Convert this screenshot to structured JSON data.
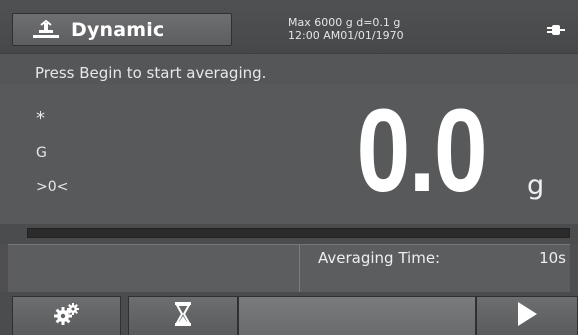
{
  "header": {
    "mode_label": "Dynamic",
    "mode_icon": "scale-balance-icon",
    "capacity_line": "Max 6000 g  d=0.1 g",
    "datetime_line": "12:00 AM01/01/1970",
    "power_icon": "power-plug-icon"
  },
  "message": "Press Begin to start averaging.",
  "display": {
    "stable_indicator": "*",
    "gross_indicator": "G",
    "zero_indicator": ">0<",
    "weight": "0.0",
    "unit": "g"
  },
  "progress": {
    "value_percent": 0,
    "fill_color": "#8cb3d8"
  },
  "info": {
    "averaging_time_label": "Averaging Time:",
    "averaging_time_value": "10s"
  },
  "toolbar": {
    "settings_icon": "gears-icon",
    "timer_icon": "hourglass-icon",
    "start_icon": "play-icon"
  }
}
